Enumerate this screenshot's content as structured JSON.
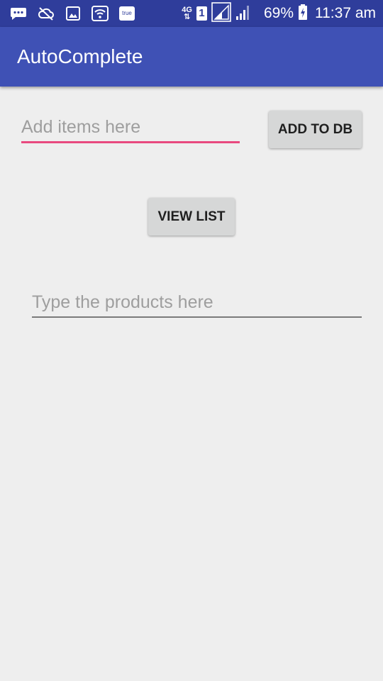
{
  "status_bar": {
    "icons_left": [
      "message-icon",
      "cloud-off-icon",
      "image-icon",
      "wifi-icon",
      "true-app-icon"
    ],
    "true_app_label": "true",
    "network_type": "4G",
    "sim_slot": "1",
    "battery_percent": "69%",
    "time": "11:37 am"
  },
  "app_bar": {
    "title": "AutoComplete"
  },
  "form": {
    "items_placeholder": "Add items here",
    "items_value": "",
    "add_button_label": "ADD TO DB",
    "view_button_label": "VIEW LIST",
    "products_placeholder": "Type the products here",
    "products_value": ""
  },
  "colors": {
    "status_bar": "#2f3d9b",
    "app_bar": "#3f51b5",
    "accent": "#e8497f",
    "background": "#eeeeee"
  }
}
